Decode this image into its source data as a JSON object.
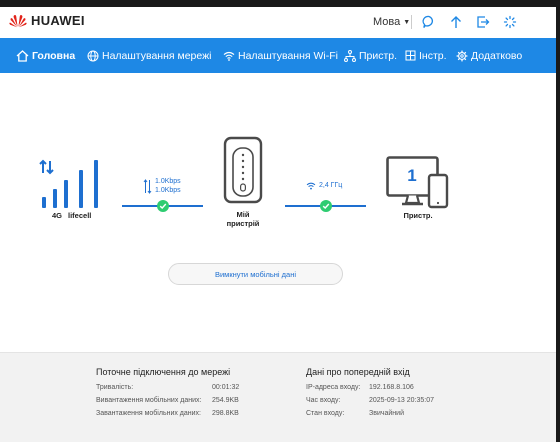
{
  "header": {
    "brand": "HUAWEI",
    "language_label": "Мова",
    "icons": [
      "message-icon",
      "update-arrow-icon",
      "logout-icon",
      "loading-spinner-icon"
    ]
  },
  "nav": {
    "items": [
      {
        "label": "Головна",
        "icon": "home-icon",
        "active": true
      },
      {
        "label": "Налаштування мережі",
        "icon": "globe-icon",
        "active": false
      },
      {
        "label": "Налаштування Wi-Fi",
        "icon": "wifi-icon",
        "active": false
      },
      {
        "label": "Пристр.",
        "icon": "devices-icon",
        "active": false
      },
      {
        "label": "Інстр.",
        "icon": "tools-icon",
        "active": false
      },
      {
        "label": "Додатково",
        "icon": "gear-icon",
        "active": false
      }
    ]
  },
  "diagram": {
    "network_type": "4G",
    "operator": "lifecell",
    "upload_speed": "1.0Kbps",
    "download_speed": "1.0Kbps",
    "my_device_label_line1": "Мій",
    "my_device_label_line2": "пристрій",
    "wifi_band": "2,4 ГГц",
    "connected_devices_count": "1",
    "devices_label": "Пристр.",
    "signal_bars": 5
  },
  "mobile_data_button": "Вимкнути мобільні дані",
  "current_connection": {
    "title": "Поточне підключення до мережі",
    "rows": [
      {
        "key": "Тривалість:",
        "value": "00:01:32"
      },
      {
        "key": "Вивантаження мобільних даних:",
        "value": "254.9KB"
      },
      {
        "key": "Завантаження мобільних даних:",
        "value": "298.8KB"
      }
    ]
  },
  "previous_login": {
    "title": "Дані про попередній вхід",
    "rows": [
      {
        "key": "IP-адреса входу:",
        "value": "192.168.8.106"
      },
      {
        "key": "Час входу:",
        "value": "2025-09-13 20:35:07"
      },
      {
        "key": "Стан входу:",
        "value": "Звичайний"
      }
    ]
  },
  "colors": {
    "accent": "#1e88e5",
    "link_line": "#1e6fd0",
    "ok_green": "#2ecc71",
    "device_gray": "#4a4a4a",
    "brand_red": "#e2231a"
  }
}
